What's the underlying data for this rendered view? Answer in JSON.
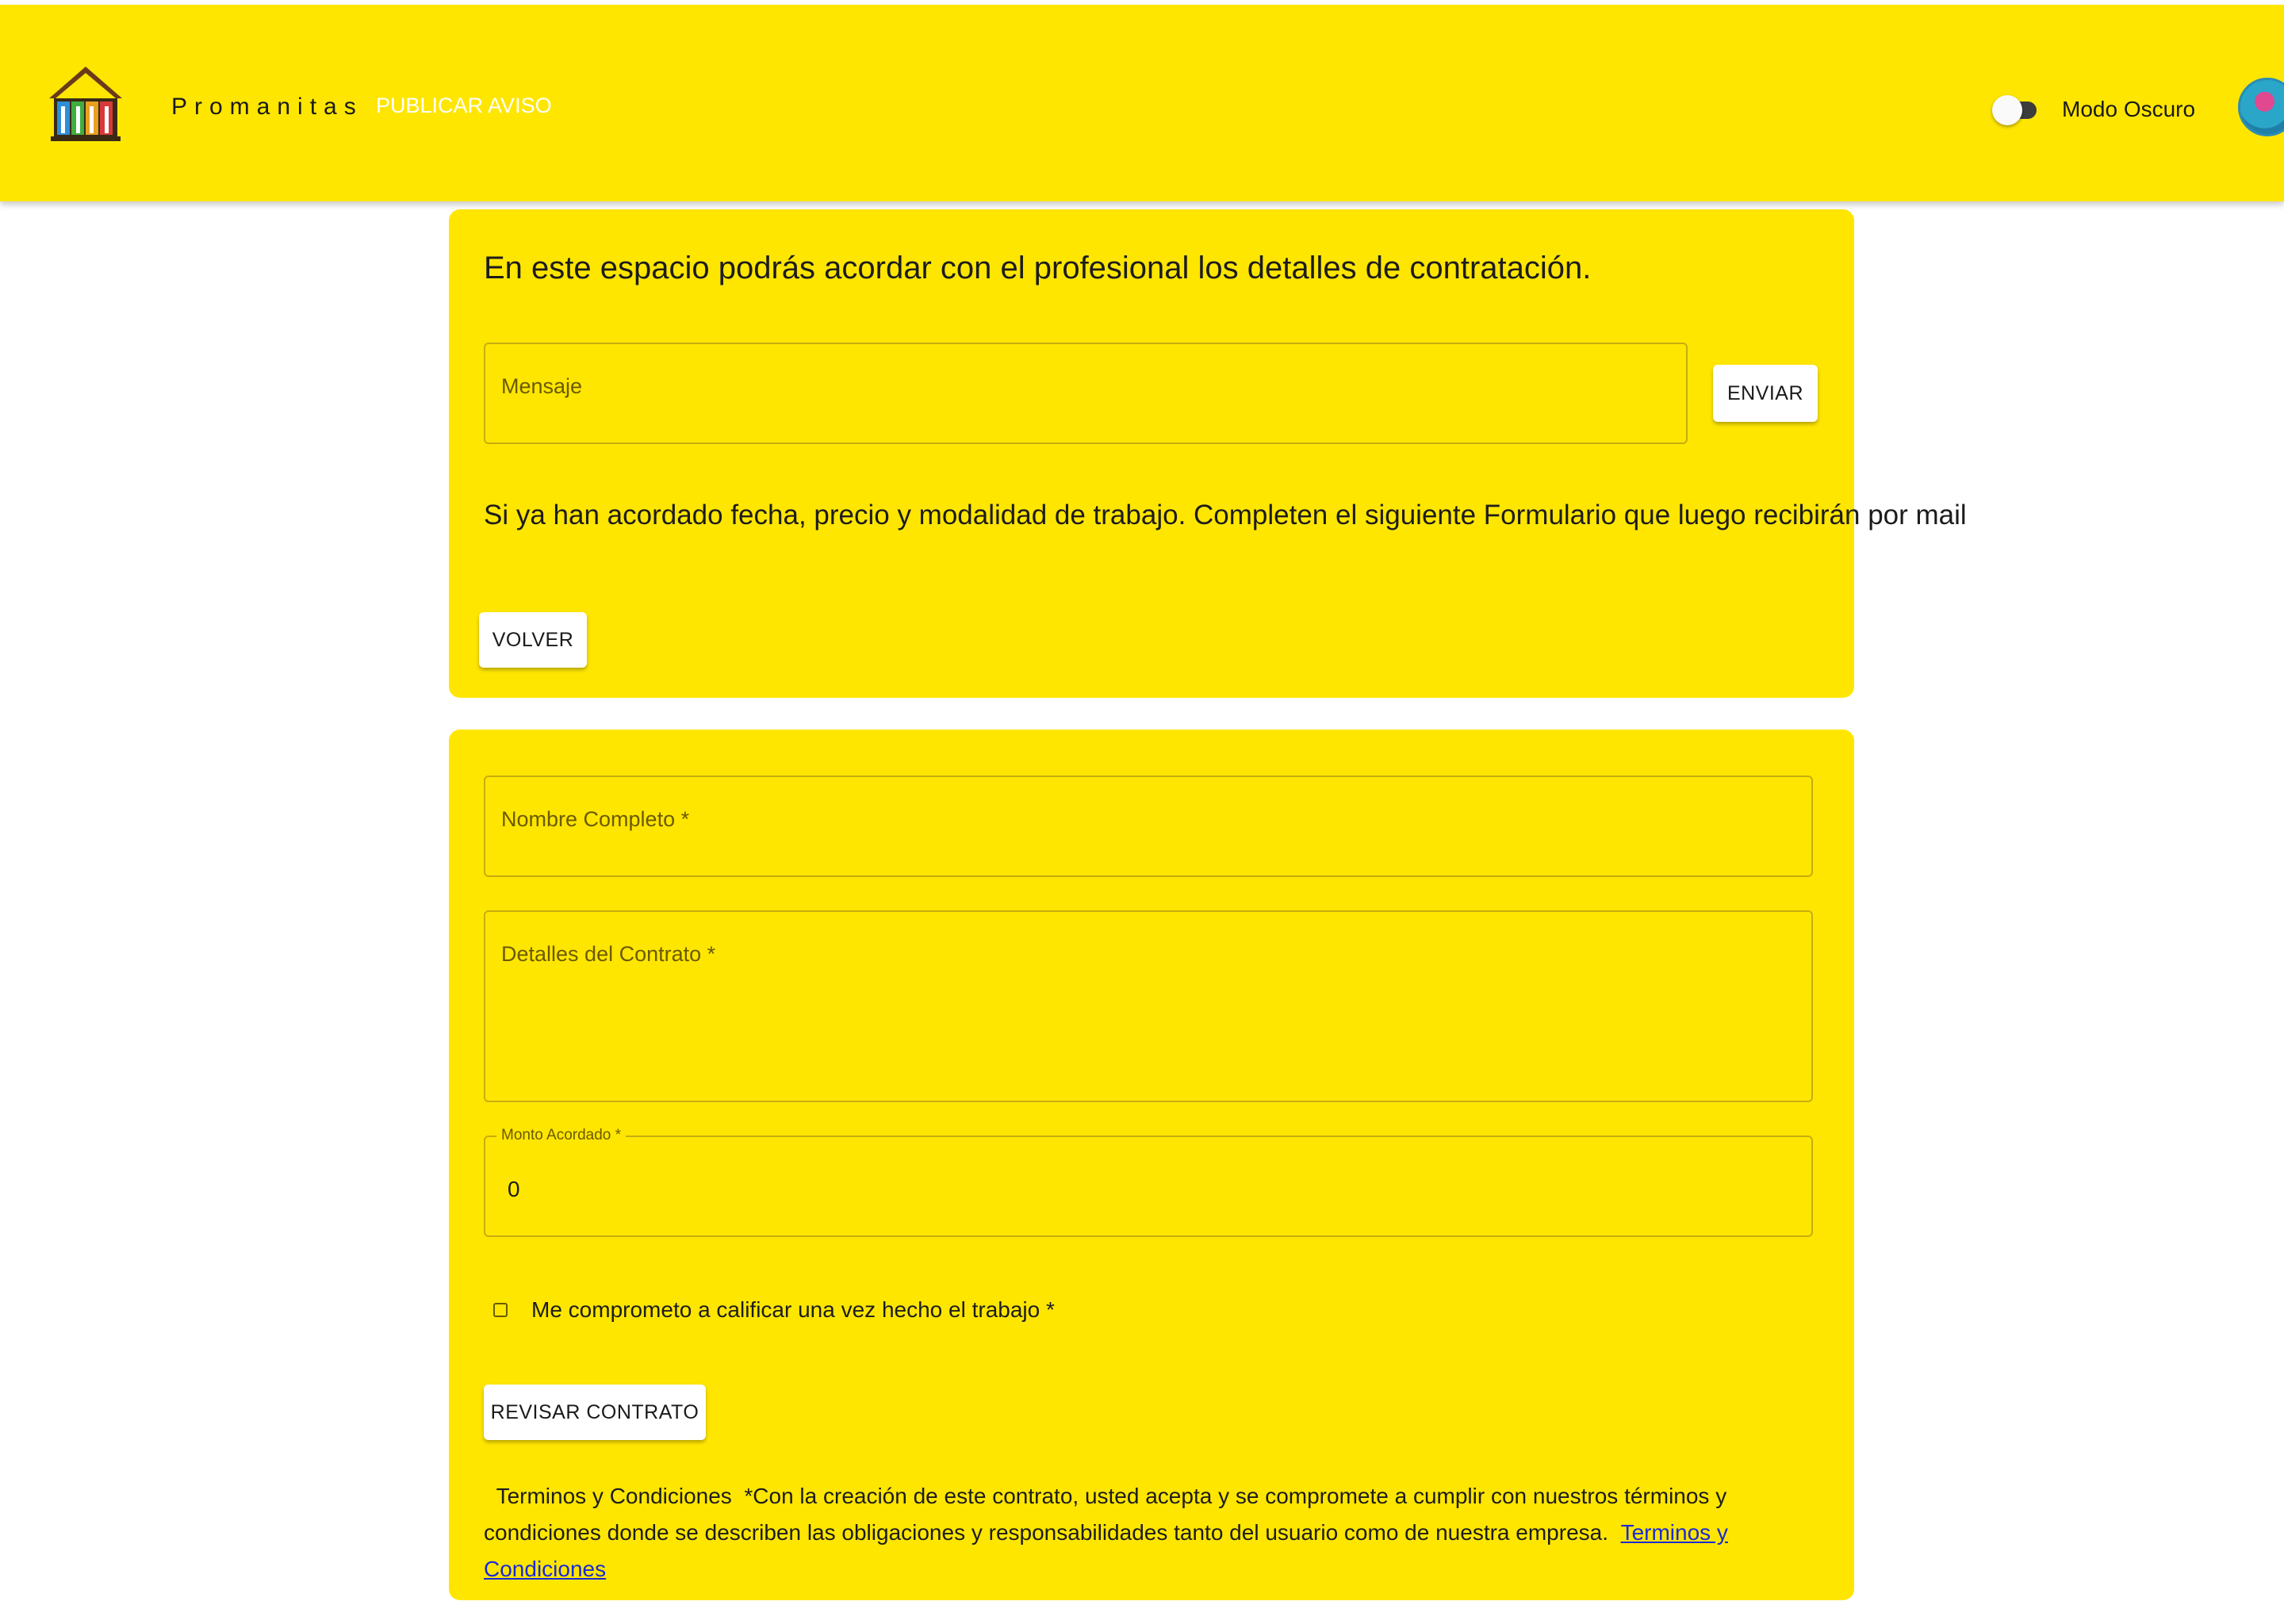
{
  "header": {
    "brand": "Promanitas",
    "publish_link": "PUBLICAR AVISO",
    "dark_mode_label": "Modo Oscuro",
    "dark_mode_on": false,
    "logo_icon": "house-tools-logo",
    "avatar_icon": "user-avatar"
  },
  "chat": {
    "intro": "En este espacio podrás acordar con el profesional los detalles de contratación.",
    "message_placeholder": "Mensaje",
    "send_label": "ENVIAR",
    "agreement_text": "Si ya han acordado fecha, precio y modalidad de trabajo. Completen el siguiente Formulario que luego recibirán por mail",
    "back_label": "VOLVER"
  },
  "form": {
    "name_placeholder": "Nombre Completo  *",
    "details_placeholder": "Detalles del Contrato  *",
    "amount_label": "Monto Acordado  *",
    "amount_value": "0",
    "commit_label": "Me comprometo a calificar una vez hecho el trabajo   *",
    "commit_checked": false,
    "review_label": "REVISAR CONTRATO",
    "terms_prefix": "Terminos y Condiciones",
    "terms_text": "*Con la creación de este contrato, usted acepta y se compromete a cumplir con nuestros términos y condiciones donde se describen las obligaciones y responsabilidades tanto del usuario como de nuestra empresa.",
    "terms_link": "Terminos y Condiciones"
  },
  "colors": {
    "primary": "#ffe600",
    "link": "#1a2ad6",
    "publish_link": "#ffffff"
  }
}
